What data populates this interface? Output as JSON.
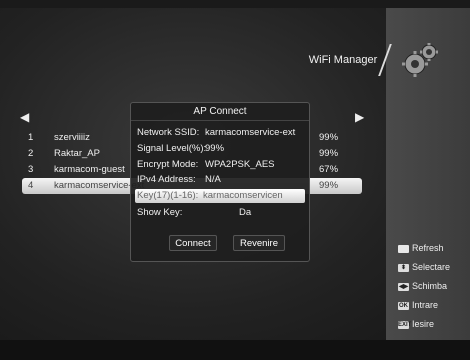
{
  "header": {
    "title": "WiFi Manager",
    "icon": "gear-icon"
  },
  "list": {
    "rows": [
      {
        "num": "1",
        "ssid": "szerviiiiz",
        "level": "99%"
      },
      {
        "num": "2",
        "ssid": "Raktar_AP",
        "level": "99%"
      },
      {
        "num": "3",
        "ssid": "karmacom-guest",
        "level": "67%"
      },
      {
        "num": "4",
        "ssid": "karmacomservice-ext",
        "level": "99%"
      }
    ],
    "selected_index": 4
  },
  "dialog": {
    "title": "AP Connect",
    "fields": {
      "ssid_label": "Network SSID:",
      "ssid_value": "karmacomservice-ext",
      "signal_label": "Signal Level(%):",
      "signal_value": "99%",
      "encrypt_label": "Encrypt Mode:",
      "encrypt_value": "WPA2PSK_AES",
      "ipv4_label": "IPv4 Address:",
      "ipv4_value": "N/A",
      "key_label": "Key(17)(1-16):",
      "key_value": "karmacomservicen",
      "showkey_label": "Show Key:",
      "showkey_value": "Da"
    },
    "buttons": {
      "connect": "Connect",
      "back": "Revenire"
    }
  },
  "legend": [
    {
      "icon": "red-key-icon",
      "label": "Refresh"
    },
    {
      "icon": "updown-key-icon",
      "label": "Selectare"
    },
    {
      "icon": "leftright-key-icon",
      "label": "Schimba"
    },
    {
      "icon": "ok-key-icon",
      "label": "Intrare"
    },
    {
      "icon": "exit-key-icon",
      "label": "Iesire"
    }
  ],
  "legend_keys": {
    "ok": "OK",
    "exit": "EXIT"
  }
}
